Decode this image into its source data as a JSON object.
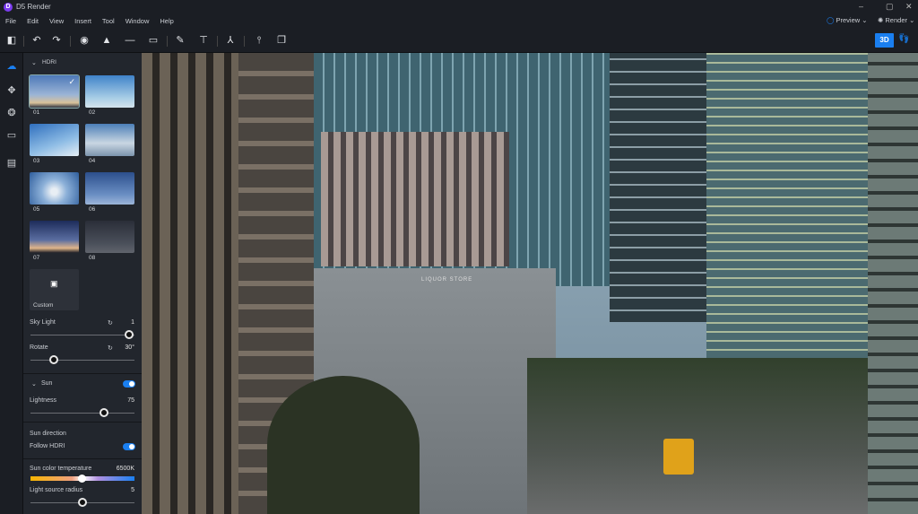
{
  "app": {
    "title": "D5 Render",
    "logo_letter": "D"
  },
  "window": {
    "minimize": "–",
    "maximize": "▢",
    "close": "✕"
  },
  "menu": [
    "File",
    "Edit",
    "View",
    "Insert",
    "Tool",
    "Window",
    "Help"
  ],
  "header": {
    "preview_label": "Preview",
    "render_label": "Render",
    "mode_label": "3D"
  },
  "panel": {
    "hdri_title": "HDRI",
    "thumbs": [
      "01",
      "02",
      "03",
      "04",
      "05",
      "06",
      "07",
      "08"
    ],
    "custom_label": "Custom",
    "sky_light": {
      "label": "Sky Light",
      "value": "1",
      "fraction": 1.0
    },
    "rotate": {
      "label": "Rotate",
      "value": "30°",
      "fraction": 0.23
    },
    "sun": {
      "title": "Sun",
      "enabled": true
    },
    "lightness": {
      "label": "Lightness",
      "value": "75",
      "fraction": 0.73
    },
    "sun_direction_label": "Sun direction",
    "follow_hdri": {
      "label": "Follow HDRI",
      "enabled": true
    },
    "sun_color_temp": {
      "label": "Sun color temperature",
      "value": "6500K",
      "fraction": 0.5
    },
    "light_radius": {
      "label": "Light source radius",
      "value": "5",
      "fraction": 0.5
    }
  },
  "scene": {
    "sign_text": "LIQUOR STORE"
  },
  "colors": {
    "accent": "#1a7ff0",
    "panel": "#22262d",
    "background": "#1b1e24"
  }
}
